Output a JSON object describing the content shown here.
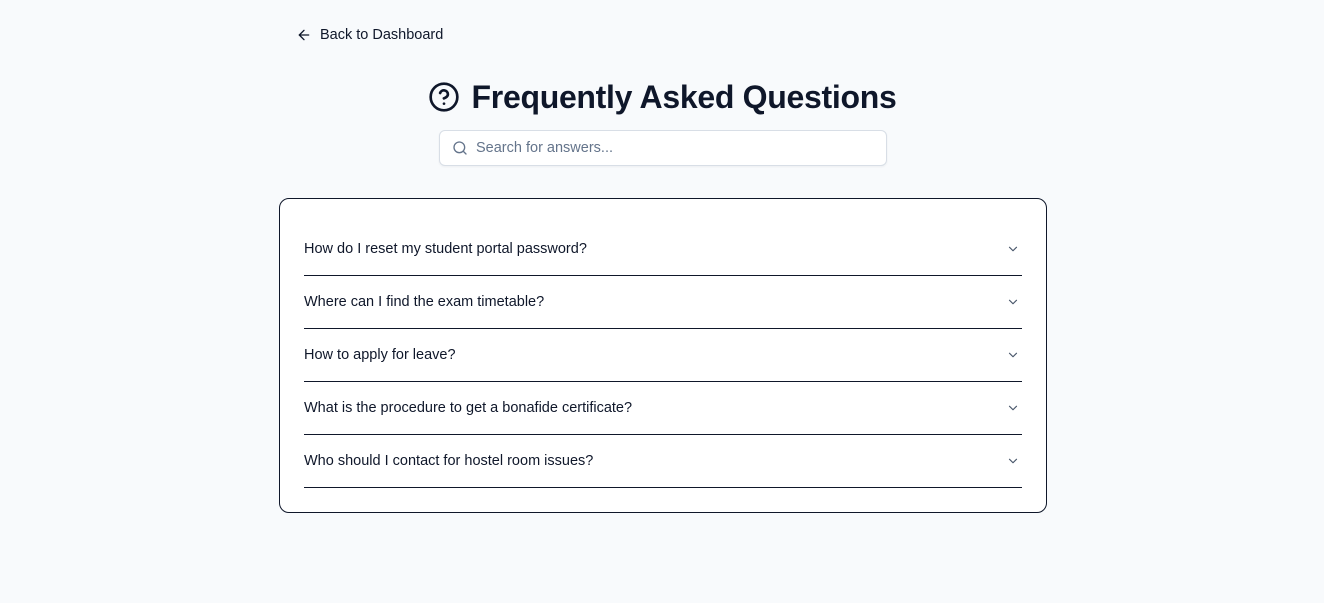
{
  "nav": {
    "back_label": "Back to Dashboard",
    "back_icon": "arrow-left-icon"
  },
  "header": {
    "title": "Frequently Asked Questions",
    "icon": "help-circle-icon"
  },
  "search": {
    "placeholder": "Search for answers...",
    "value": "",
    "icon": "search-icon"
  },
  "faq": {
    "items": [
      {
        "question": "How do I reset my student portal password?",
        "expanded": false
      },
      {
        "question": "Where can I find the exam timetable?",
        "expanded": false
      },
      {
        "question": "How to apply for leave?",
        "expanded": false
      },
      {
        "question": "What is the procedure to get a bonafide certificate?",
        "expanded": false
      },
      {
        "question": "Who should I contact for hostel room issues?",
        "expanded": false
      }
    ]
  },
  "colors": {
    "background": "#f8fafc",
    "text": "#0f172a",
    "muted": "#64748b",
    "border": "#d8dee6"
  }
}
